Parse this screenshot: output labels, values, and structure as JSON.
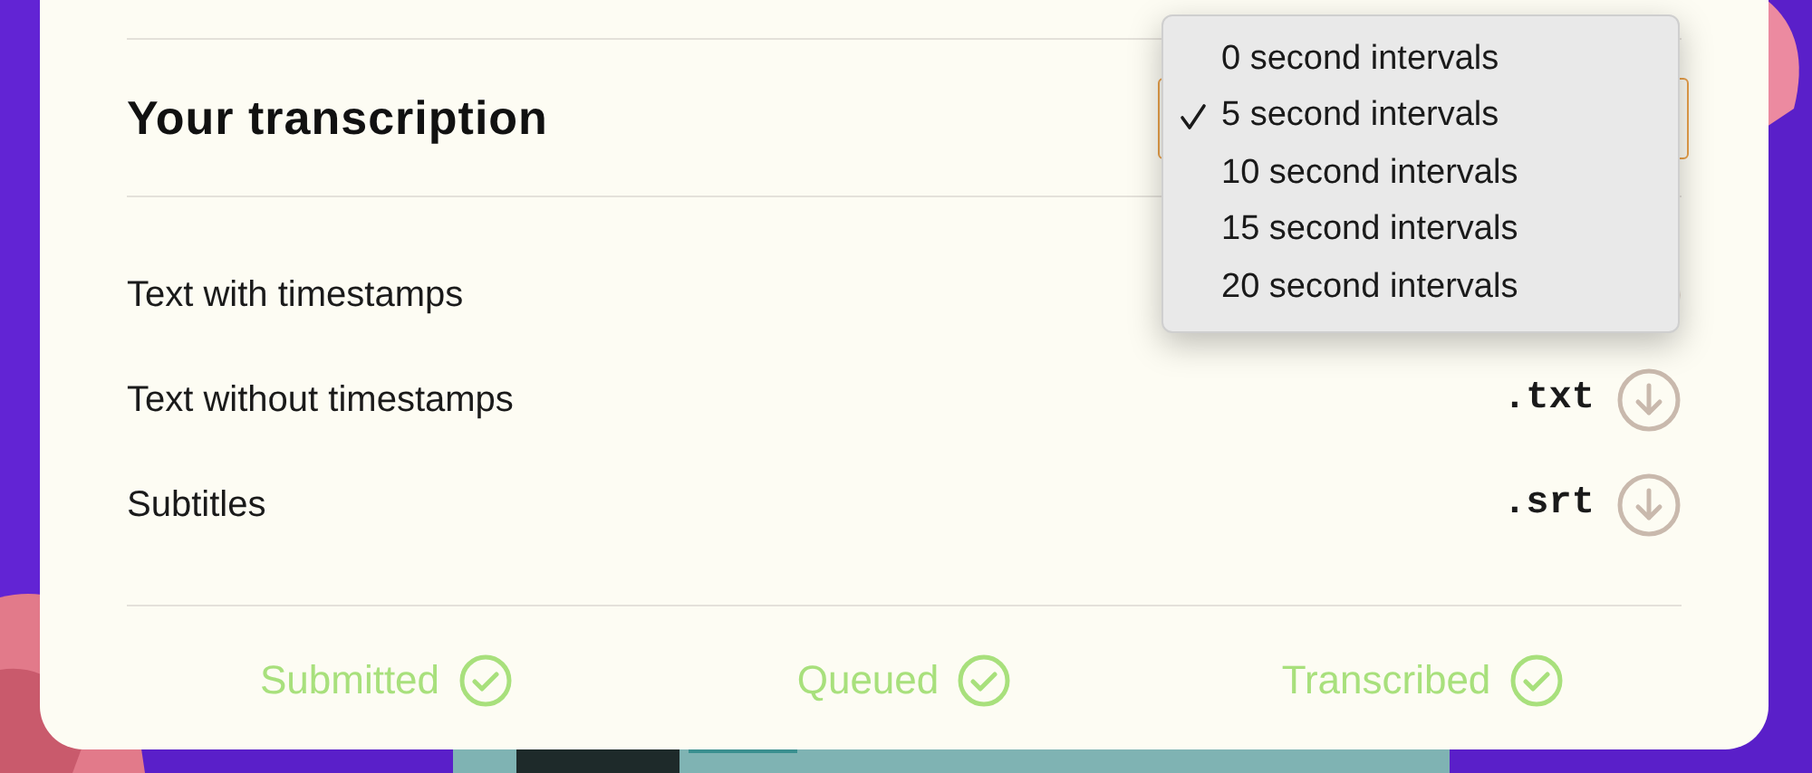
{
  "section": {
    "title": "Your transcription"
  },
  "menu": {
    "items": [
      {
        "label": "0 second intervals",
        "selected": false
      },
      {
        "label": "5 second intervals",
        "selected": true
      },
      {
        "label": "10 second intervals",
        "selected": false
      },
      {
        "label": "15 second intervals",
        "selected": false
      },
      {
        "label": "20 second intervals",
        "selected": false
      }
    ]
  },
  "downloads": [
    {
      "label": "Text with timestamps"
    },
    {
      "label": "Text without timestamps",
      "extension": ".txt"
    },
    {
      "label": "Subtitles",
      "extension": ".srt"
    }
  ],
  "statuses": [
    {
      "label": "Submitted",
      "done": true
    },
    {
      "label": "Queued",
      "done": true
    },
    {
      "label": "Transcribed",
      "done": true
    }
  ]
}
